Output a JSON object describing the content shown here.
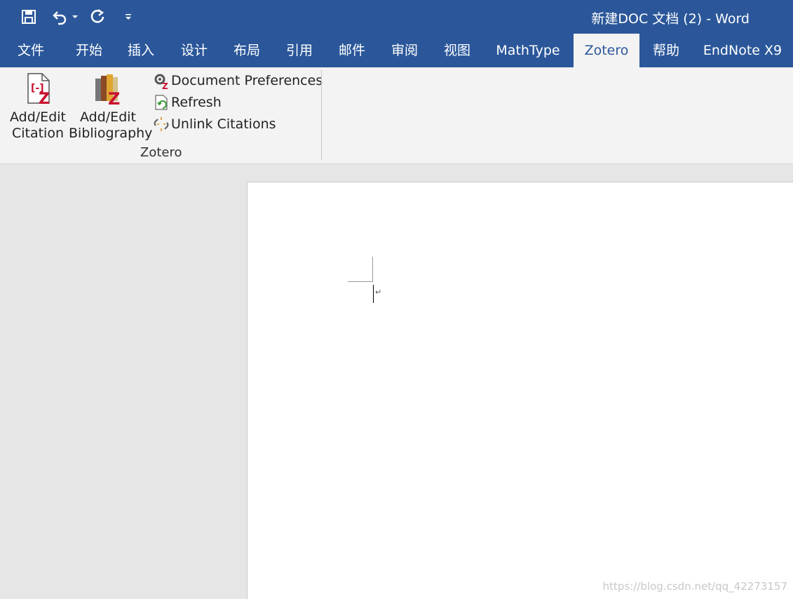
{
  "titlebar": {
    "title": "新建DOC 文档 (2)  -  Word",
    "qat": [
      "save-icon",
      "undo-icon",
      "undo-dropdown-icon",
      "redo-icon",
      "customize-qat-icon"
    ]
  },
  "tabs": [
    {
      "label": "文件"
    },
    {
      "label": "开始"
    },
    {
      "label": "插入"
    },
    {
      "label": "设计"
    },
    {
      "label": "布局"
    },
    {
      "label": "引用"
    },
    {
      "label": "邮件"
    },
    {
      "label": "审阅"
    },
    {
      "label": "视图"
    },
    {
      "label": "MathType"
    },
    {
      "label": "Zotero"
    },
    {
      "label": "帮助"
    },
    {
      "label": "EndNote X9"
    }
  ],
  "ribbon": {
    "add_citation": {
      "line1": "Add/Edit",
      "line2": "Citation"
    },
    "add_bibliography": {
      "line1": "Add/Edit",
      "line2": "Bibliography"
    },
    "doc_prefs": "Document Preferences",
    "refresh": "Refresh",
    "unlink": "Unlink Citations",
    "group_label": "Zotero"
  },
  "document": {
    "paragraph_mark": "↵"
  },
  "watermark": "https://blog.csdn.net/qq_42273157",
  "colors": {
    "accent": "#2b579a",
    "ribbon_bg": "#f3f3f3",
    "zotero_red": "#c8102e"
  }
}
